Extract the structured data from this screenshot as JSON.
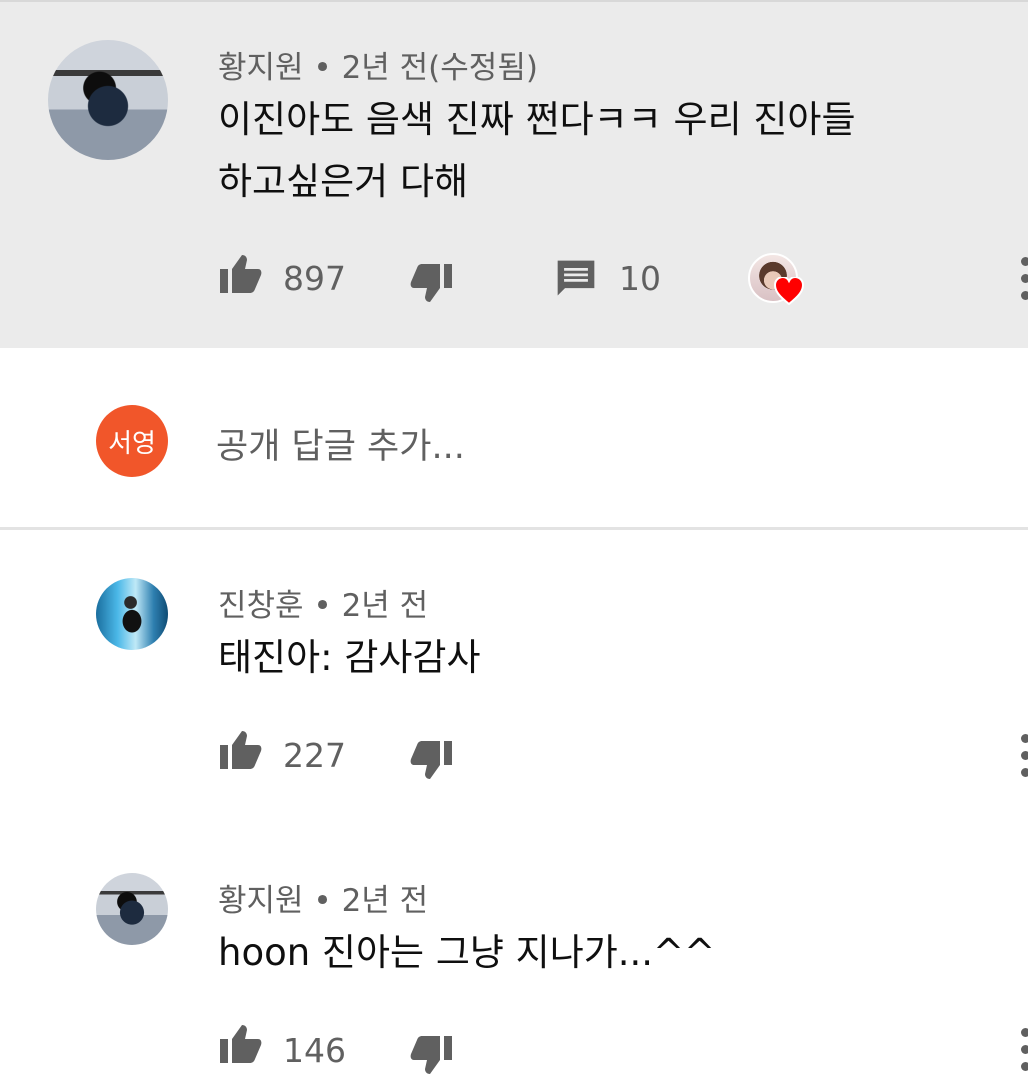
{
  "comments": [
    {
      "author": "황지원",
      "separator": " • ",
      "time": "2년 전(수정됨)",
      "text_lines": [
        "이진아도 음색 진짜 쩐다ㅋㅋ 우리 진아들",
        "하고싶은거 다해"
      ],
      "likes": "897",
      "replies": "10"
    },
    {
      "author": "진창훈",
      "separator": " • ",
      "time": "2년 전",
      "text_lines": [
        "태진아: 감사감사"
      ],
      "likes": "227"
    },
    {
      "author": "황지원",
      "separator": " • ",
      "time": "2년 전",
      "text_lines": [
        "hoon 진아는 그냥 지나가...^^"
      ],
      "likes": "146"
    }
  ],
  "reply_box": {
    "avatar_initials": "서영",
    "placeholder": "공개 답글 추가..."
  },
  "icons": {
    "like": "thumbs-up-icon",
    "dislike": "thumbs-down-icon",
    "reply": "comment-icon",
    "more": "more-vert-icon",
    "heart": "creator-heart-icon"
  },
  "colors": {
    "highlight_bg": "#ebebeb",
    "secondary_text": "#606060",
    "primary_text": "#0f0f0f",
    "avatar_initials_bg": "#f1562a",
    "heart": "#ff0000"
  }
}
